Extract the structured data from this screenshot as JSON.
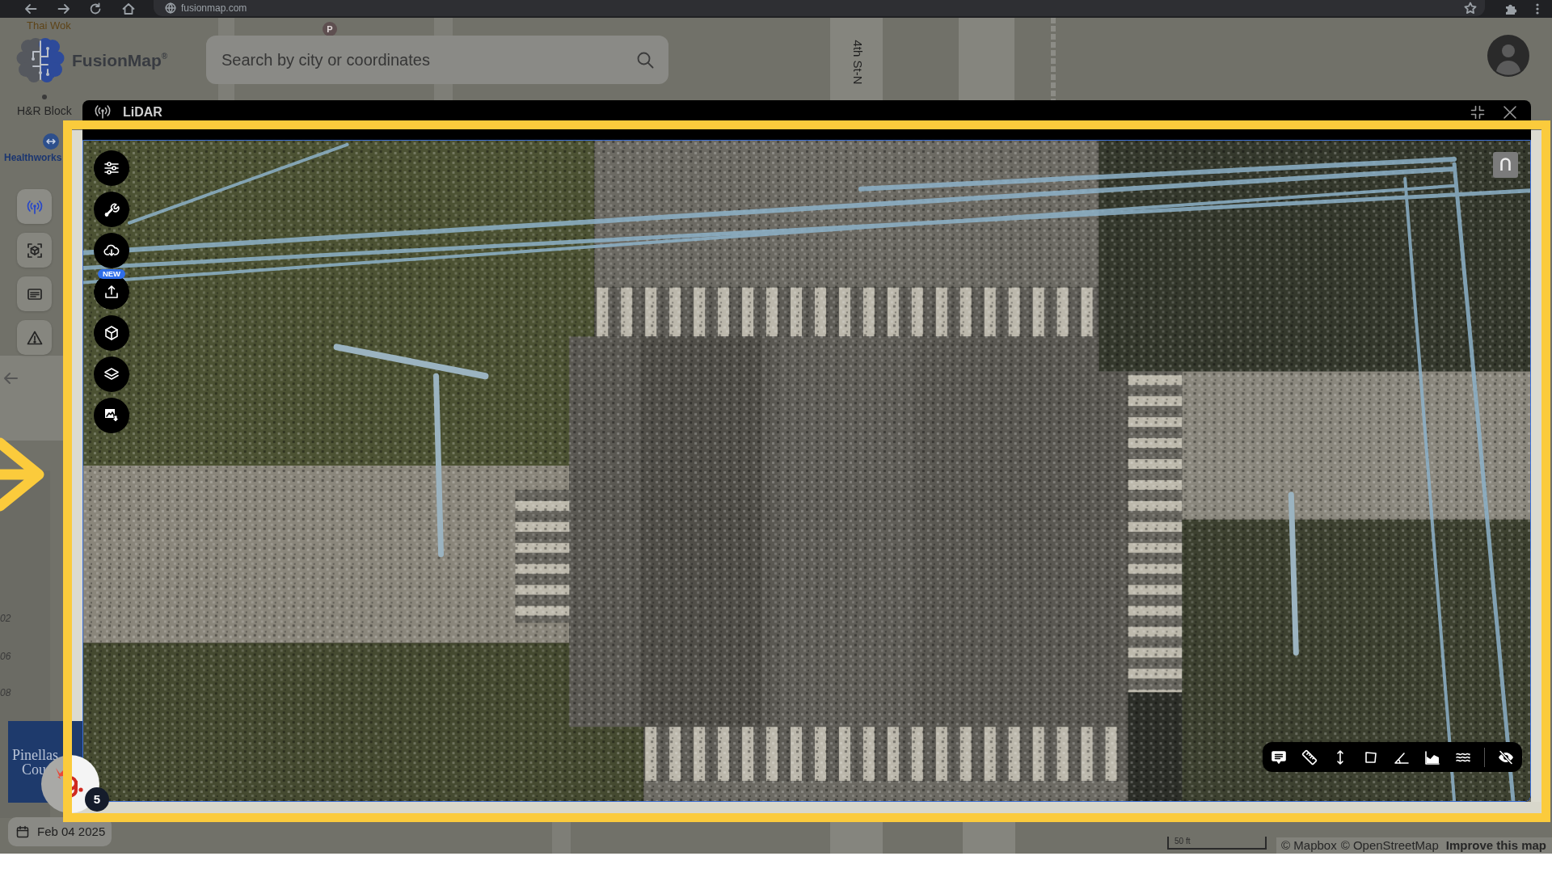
{
  "browser": {
    "url": "fusionmap.com"
  },
  "map_labels": [
    {
      "kind": "restaurant",
      "text": "Thai Wok"
    },
    {
      "kind": "business",
      "text": "H&R Block"
    },
    {
      "kind": "health",
      "text": "Healthworks"
    },
    {
      "kind": "street",
      "text": "4th St-N"
    },
    {
      "kind": "parking",
      "text": "P"
    }
  ],
  "side_labels": [
    "02",
    "06",
    "08"
  ],
  "logo": {
    "text": "FusionMap$^{®}$"
  },
  "search": {
    "placeholder": "Search by city or coordinates"
  },
  "sidebar": {
    "items": [
      {
        "selected": true
      },
      {
        "selected": false
      },
      {
        "selected": false
      },
      {
        "selected": false
      }
    ]
  },
  "lidar_window": {
    "title": "LiDAR",
    "tool_badge": "NEW"
  },
  "county_logo": {
    "lines": [
      "Pinellas",
      "Cou"
    ]
  },
  "chat_widget": {
    "count": "5"
  },
  "date_chip": {
    "text": "Feb 04 2025"
  },
  "scale_bar": {
    "label": "50 ft"
  },
  "attribution": [
    {
      "kind": "credit",
      "text": "© Mapbox"
    },
    {
      "kind": "credit",
      "text": "© OpenStreetMap"
    },
    {
      "kind": "feedback",
      "text": "Improve this map"
    }
  ]
}
